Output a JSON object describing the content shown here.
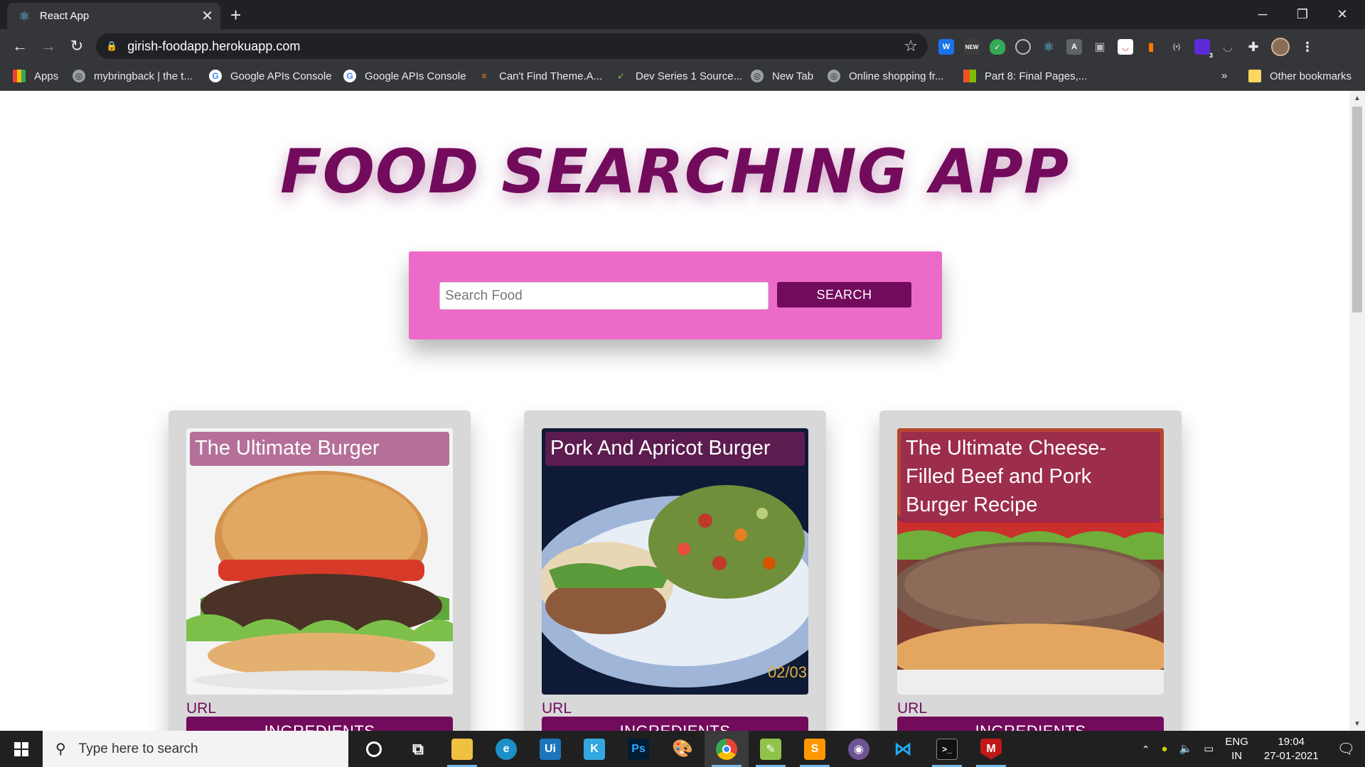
{
  "browser": {
    "tab_title": "React App",
    "tab_close": "✕",
    "new_tab": "+",
    "url": "girish-foodapp.herokuapp.com",
    "window_controls": {
      "minimize": "─",
      "restore": "❐",
      "close": "✕"
    }
  },
  "extensions_badge": "3",
  "bookmarks": {
    "items": [
      "Apps",
      "mybringback | the t...",
      "Google APIs Console",
      "Google APIs Console",
      "Can't Find Theme.A...",
      "Dev Series 1 Source...",
      "New Tab",
      "Online shopping fr...",
      "Part 8: Final Pages,..."
    ],
    "overflow": "»",
    "other": "Other bookmarks"
  },
  "app": {
    "title": "FOOD SEARCHING APP",
    "search": {
      "placeholder": "Search Food",
      "value": "",
      "button": "SEARCH"
    },
    "cards": [
      {
        "title": "The Ultimate Burger",
        "url_label": "URL",
        "button": "INGREDIENTS"
      },
      {
        "title": "Pork And Apricot Burger",
        "url_label": "URL",
        "button": "INGREDIENTS",
        "photo_text": "02/03"
      },
      {
        "title": "The Ultimate Cheese-Filled Beef and Pork Burger Recipe",
        "url_label": "URL",
        "button": "INGREDIENTS"
      }
    ]
  },
  "taskbar": {
    "search_placeholder": "Type here to search",
    "language": "ENG",
    "region": "IN",
    "time": "19:04",
    "date": "27-01-2021"
  },
  "colors": {
    "brand": "#730b5c",
    "search_panel": "#ec6ac8",
    "card_bg": "#d8d8d8"
  }
}
